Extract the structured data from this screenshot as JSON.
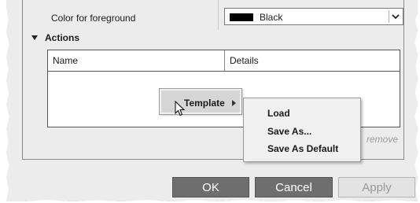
{
  "foreground": {
    "label": "Color for foreground",
    "selected_color": "Black",
    "swatch_color": "#000000"
  },
  "actions": {
    "heading": "Actions",
    "columns": [
      "Name",
      "Details"
    ],
    "remove_label": "remove"
  },
  "context_menu": {
    "template_label": "Template",
    "submenu_items": [
      "Load",
      "Save As...",
      "Save As Default"
    ]
  },
  "buttons": {
    "ok": "OK",
    "cancel": "Cancel",
    "apply": "Apply"
  },
  "icons": {
    "collapse": "triangle-down-icon",
    "dropdown": "chevron-down-icon",
    "submenu": "triangle-right-icon",
    "pointer": "mouse-pointer-icon"
  }
}
